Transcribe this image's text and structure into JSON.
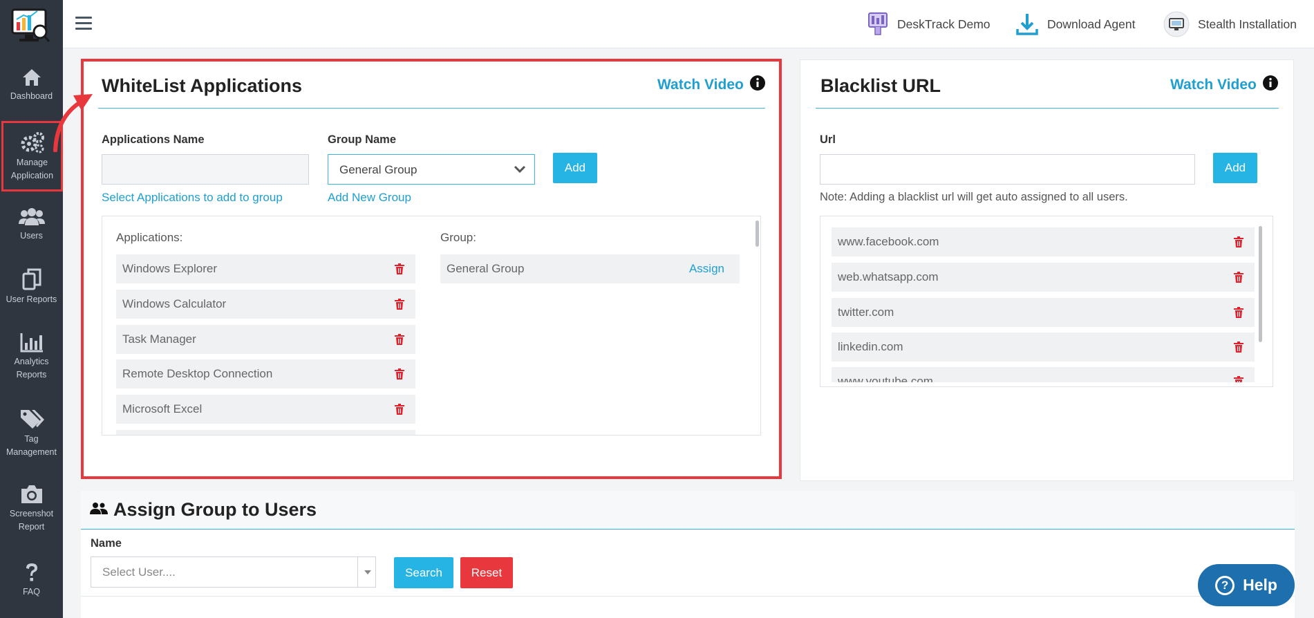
{
  "sidebar": {
    "items": [
      {
        "label": "Dashboard"
      },
      {
        "label": "Manage Application"
      },
      {
        "label": "Users"
      },
      {
        "label": "User Reports"
      },
      {
        "label": "Analytics Reports"
      },
      {
        "label": "Tag Management"
      },
      {
        "label": "Screenshot Report"
      },
      {
        "label": "FAQ"
      }
    ]
  },
  "topbar": {
    "demo_label": "DeskTrack Demo",
    "download_label": "Download Agent",
    "stealth_label": "Stealth Installation"
  },
  "whitelist": {
    "title": "WhiteList Applications",
    "watch_video": "Watch Video",
    "app_name_label": "Applications Name",
    "app_name_value": "",
    "group_name_label": "Group Name",
    "group_selected": "General Group",
    "add_label": "Add",
    "select_apps_link": "Select Applications to add to group",
    "add_group_link": "Add New Group",
    "applications_label": "Applications:",
    "group_label": "Group:",
    "applications": [
      "Windows Explorer",
      "Windows Calculator",
      "Task Manager",
      "Remote Desktop Connection",
      "Microsoft Excel"
    ],
    "groups": [
      {
        "name": "General Group",
        "action": "Assign"
      }
    ]
  },
  "blacklist": {
    "title": "Blacklist URL",
    "watch_video": "Watch Video",
    "url_label": "Url",
    "url_value": "",
    "add_label": "Add",
    "note": "Note: Adding a blacklist url will get auto assigned to all users.",
    "urls": [
      "www.facebook.com",
      "web.whatsapp.com",
      "twitter.com",
      "linkedin.com",
      "www.youtube.com"
    ]
  },
  "assign_section": {
    "title": "Assign Group to Users",
    "name_label": "Name",
    "user_placeholder": "Select User....",
    "search_label": "Search",
    "reset_label": "Reset"
  },
  "help_label": "Help",
  "colors": {
    "accent": "#25b4e3",
    "danger": "#e8383d",
    "sidebar": "#2f3640",
    "help": "#1e6fae"
  }
}
